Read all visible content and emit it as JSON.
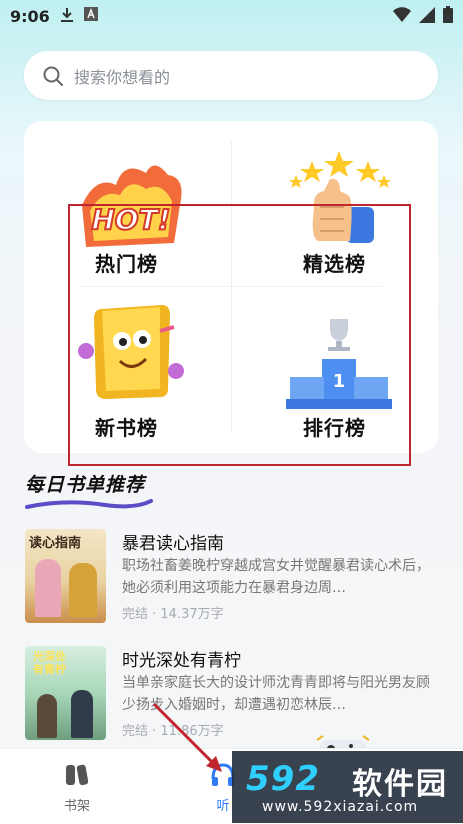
{
  "status": {
    "time": "9:06"
  },
  "search": {
    "placeholder": "搜索你想看的"
  },
  "rankings": {
    "hot_label": "热门榜",
    "picked_label": "精选榜",
    "new_label": "新书榜",
    "rank_label": "排行榜",
    "hot_badge": "HOT!"
  },
  "section": {
    "title": "每日书单推荐"
  },
  "books": [
    {
      "title": "暴君读心指南",
      "desc": "职场社畜姜晚柠穿越成宫女并觉醒暴君读心术后，她必须利用这项能力在暴君身边周…",
      "meta": "完结 · 14.37万字",
      "cover_text": "读心指南"
    },
    {
      "title": "时光深处有青柠",
      "desc": "当单亲家庭长大的设计师沈青青即将与阳光男友顾少扬步入婚姻时，却遭遇初恋林辰…",
      "meta": "完结 · 11.86万字",
      "cover_text": "光深处有青柠"
    }
  ],
  "tabbar": {
    "bookshelf": "书架",
    "listen": "听"
  },
  "watermark": {
    "brand": "592",
    "cn": "软件园",
    "url": "www.592xiazai.com"
  },
  "colors": {
    "accent": "#2f7cf6",
    "box": "#c0262d",
    "hot": "#e8452f"
  }
}
